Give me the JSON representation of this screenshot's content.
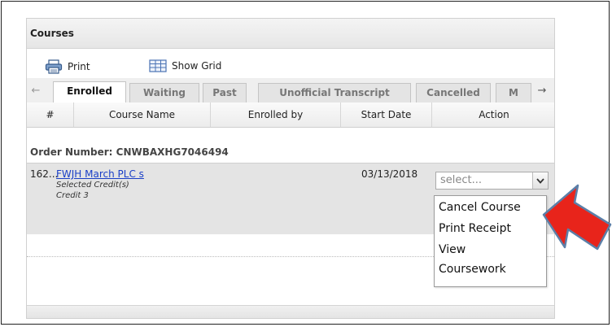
{
  "panel": {
    "title": "Courses"
  },
  "toolbar": {
    "print_label": "Print",
    "show_grid_label": "Show Grid"
  },
  "tabs": [
    {
      "label": "Enrolled",
      "active": true
    },
    {
      "label": "Waiting",
      "active": false
    },
    {
      "label": "Past",
      "active": false
    },
    {
      "label": "Unofficial Transcript",
      "active": false
    },
    {
      "label": "Cancelled",
      "active": false
    },
    {
      "label": "M",
      "active": false
    }
  ],
  "table": {
    "columns": [
      "#",
      "Course Name",
      "Enrolled by",
      "Start Date",
      "Action"
    ],
    "order_number": "Order Number: CNWBAXHG7046494",
    "rows": [
      {
        "num": "162...",
        "course_name": "FWJH March PLC s",
        "sub1": "Selected Credit(s)",
        "sub2": "Credit 3",
        "start_date": "03/13/2018",
        "action_placeholder": "select..."
      }
    ]
  },
  "dropdown": {
    "options": [
      "Cancel Course",
      "Print Receipt",
      "View",
      "Coursework"
    ]
  },
  "icons": {
    "print": "printer-icon",
    "grid": "grid-icon",
    "tab_prev": "arrow-left-icon",
    "tab_next": "arrow-right-icon",
    "dropdown": "chevron-down-icon",
    "callout": "red-arrow-icon"
  },
  "colors": {
    "link": "#1a3fc7",
    "callout_red": "#e8241b",
    "callout_border": "#5b7fa8"
  }
}
